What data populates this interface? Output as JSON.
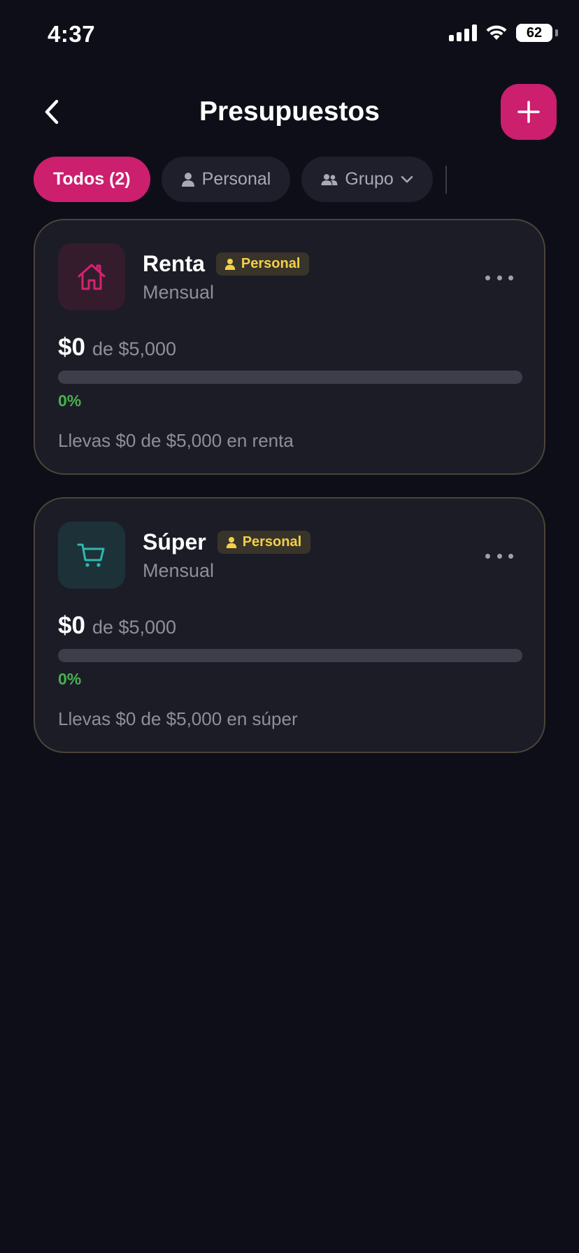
{
  "status_bar": {
    "time": "4:37",
    "battery": "62"
  },
  "header": {
    "title": "Presupuestos"
  },
  "filters": [
    {
      "label": "Todos (2)"
    },
    {
      "label": "Personal"
    },
    {
      "label": "Grupo"
    }
  ],
  "budgets": [
    {
      "name": "Renta",
      "badge": "Personal",
      "period": "Mensual",
      "spent": "$0",
      "of_total": "de $5,000",
      "progress_percent": 0,
      "percent_label": "0%",
      "summary": "Llevas $0 de $5,000 en renta",
      "icon": "home-icon"
    },
    {
      "name": "Súper",
      "badge": "Personal",
      "period": "Mensual",
      "spent": "$0",
      "of_total": "de $5,000",
      "progress_percent": 0,
      "percent_label": "0%",
      "summary": "Llevas $0 de $5,000 en súper",
      "icon": "shopping-cart-icon"
    }
  ],
  "colors": {
    "background": "#0e0e19",
    "accent": "#cc1f6e",
    "card": "#1c1c27",
    "badge_text": "#f2cf4a",
    "percent": "#48b14e",
    "home_icon": "#d3236f",
    "cart_icon": "#2fb8b0"
  }
}
